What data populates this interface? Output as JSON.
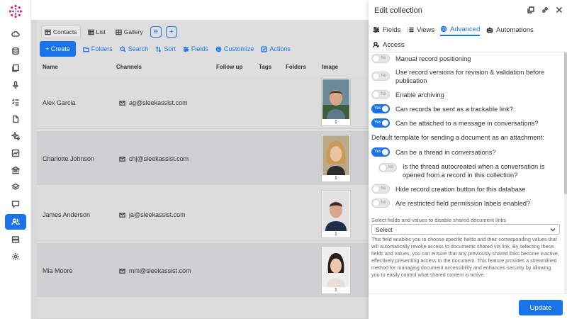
{
  "background": {
    "tabs": [
      {
        "label": "Contacts",
        "icon": "table-icon",
        "active": true
      },
      {
        "label": "List",
        "icon": "list-icon"
      },
      {
        "label": "Gallery",
        "icon": "gallery-icon"
      }
    ],
    "toolbar": {
      "create_label": "+ Create",
      "folders_label": "Folders",
      "search_label": "Search",
      "sort_label": "Sort",
      "fields_label": "Fields",
      "customize_label": "Customize",
      "actions_label": "Actions"
    },
    "columns": [
      "Name",
      "Channels",
      "Follow up",
      "Tags",
      "Folders",
      "Image"
    ],
    "rows": [
      {
        "name": "Alex Garcia",
        "email": "ag@sleekassist.com",
        "image_count": "1"
      },
      {
        "name": "Charlotte Johnson",
        "email": "chj@sleekassist.com",
        "image_count": "1"
      },
      {
        "name": "James Anderson",
        "email": "ja@sleekassist.com",
        "image_count": "1"
      },
      {
        "name": "Mia Moore",
        "email": "mm@sleekassist.com",
        "image_count": "1"
      }
    ]
  },
  "panel": {
    "title": "Edit collection",
    "tabs": [
      {
        "label": "Fields",
        "icon": "fields-icon"
      },
      {
        "label": "Views",
        "icon": "views-icon"
      },
      {
        "label": "Advanced",
        "icon": "gear-icon",
        "active": true
      },
      {
        "label": "Automations",
        "icon": "automations-icon"
      },
      {
        "label": "Access",
        "icon": "access-icon"
      }
    ],
    "toggle_yes": "Yes",
    "toggle_no": "No",
    "options": [
      {
        "label": "Manual record positioning",
        "on": false
      },
      {
        "label": "Use record versions for revision & validation before publication",
        "on": false
      },
      {
        "label": "Enable archiving",
        "on": false
      },
      {
        "label": "Can records be sent as a trackable link?",
        "on": true
      },
      {
        "label": "Can be attached to a message in conversations?",
        "on": true
      }
    ],
    "default_template_label": "Default template for sending a document as an attachment:",
    "options2": [
      {
        "label": "Can be a thread in conversations?",
        "on": true
      },
      {
        "label": "Is the thread autocreated when a conversation is opened from a record in this collection?",
        "on": false
      },
      {
        "label": "Hide record creation button for this database",
        "on": false
      },
      {
        "label": "Are restricted field permission labels enabled?",
        "on": false
      }
    ],
    "select_label": "Select fields and values to disable shared document links",
    "select_value": "Select",
    "help_text": "This field enables you to choose specific fields and their corresponding values that will automatically revoke access to documents shared via link. By selecting these fields and values, you can ensure that any previously shared links become inactive, effectively preventing access to the document. This feature provides a streamlined method for managing document accessibility and enhances security by allowing you to easily control what shared content is active.",
    "update_label": "Update"
  },
  "colors": {
    "accent": "#1a73e8"
  }
}
